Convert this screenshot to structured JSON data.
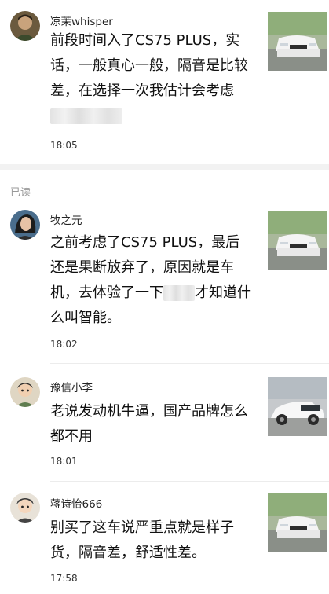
{
  "section": {
    "read_label": "已读"
  },
  "comments": [
    {
      "username": "凉茉whisper",
      "text": "前段时间入了CS75 PLUS，实话，一般真心一般，隔音是比较差，在选择一次我估计会考虑",
      "time": "18:05",
      "avatar_icon": "avatar-man-icon",
      "thumb": "car-photo-front"
    },
    {
      "username": "牧之元",
      "text": "之前考虑了CS75 PLUS，最后还是果断放弃了，原因就是车机，去体验了一下",
      "text_tail": "才知道什么叫智能。",
      "time": "18:02",
      "avatar_icon": "avatar-woman-icon",
      "thumb": "car-photo-front"
    },
    {
      "username": "豫信小李",
      "text": "老说发动机牛逼，国产品牌怎么都不用",
      "time": "18:01",
      "avatar_icon": "avatar-cartoon-icon",
      "thumb": "car-photo-side-white"
    },
    {
      "username": "蒋诗怡666",
      "text": "别买了这车说严重点就是样子货，隔音差，舒适性差。",
      "time": "17:58",
      "avatar_icon": "avatar-cartoon-boy-icon",
      "thumb": "car-photo-front"
    }
  ]
}
